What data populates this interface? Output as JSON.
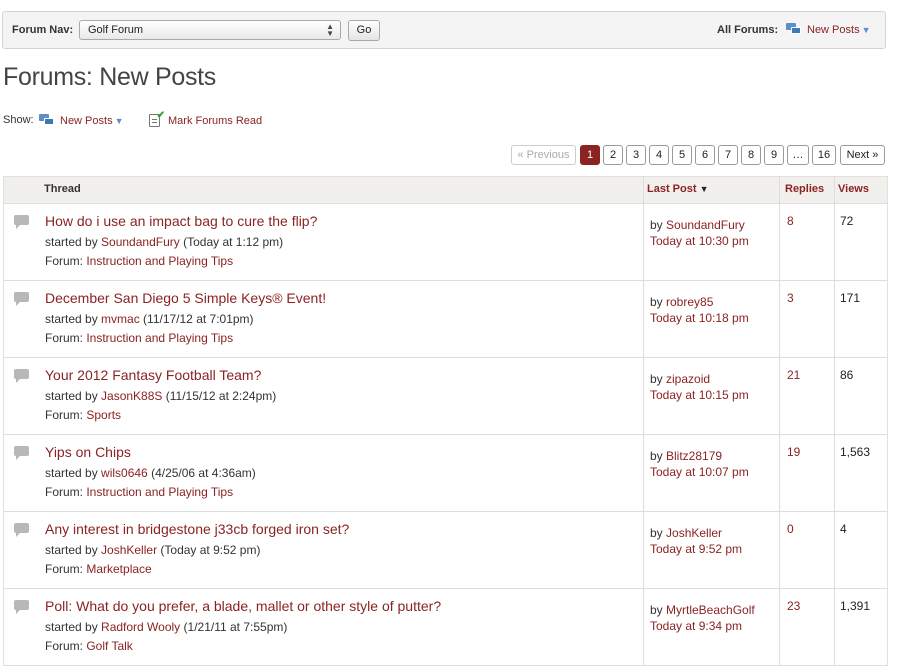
{
  "nav": {
    "label": "Forum Nav:",
    "selected_forum": "Golf Forum",
    "go_label": "Go",
    "all_forums_label": "All Forums:",
    "new_posts_label": "New Posts"
  },
  "page_title": "Forums: New Posts",
  "show": {
    "label": "Show:",
    "new_posts_label": "New Posts",
    "mark_read_label": "Mark Forums Read"
  },
  "pagination": {
    "previous": "« Previous",
    "pages": [
      "1",
      "2",
      "3",
      "4",
      "5",
      "6",
      "7",
      "8",
      "9",
      "…",
      "16"
    ],
    "current": "1",
    "next": "Next »"
  },
  "table": {
    "headers": {
      "thread": "Thread",
      "last_post": "Last Post",
      "replies": "Replies",
      "views": "Views"
    },
    "rows": [
      {
        "title": "How do i use an impact bag to cure the flip?",
        "started_prefix": "started by ",
        "author": "SoundandFury",
        "started_when": " (Today at 1:12 pm)",
        "forum_prefix": "Forum: ",
        "forum": "Instruction and Playing Tips",
        "last_by_prefix": "by ",
        "last_by": "SoundandFury",
        "last_when": "Today at 10:30 pm",
        "replies": "8",
        "views": "72"
      },
      {
        "title": "December San Diego 5 Simple Keys® Event!",
        "started_prefix": "started by ",
        "author": "mvmac",
        "started_when": " (11/17/12 at 7:01pm)",
        "forum_prefix": "Forum: ",
        "forum": "Instruction and Playing Tips",
        "last_by_prefix": "by ",
        "last_by": "robrey85",
        "last_when": "Today at 10:18 pm",
        "replies": "3",
        "views": "171"
      },
      {
        "title": "Your 2012 Fantasy Football Team?",
        "started_prefix": "started by ",
        "author": "JasonK88S",
        "started_when": " (11/15/12 at 2:24pm)",
        "forum_prefix": "Forum: ",
        "forum": "Sports",
        "last_by_prefix": "by ",
        "last_by": "zipazoid",
        "last_when": "Today at 10:15 pm",
        "replies": "21",
        "views": "86"
      },
      {
        "title": "Yips on Chips",
        "started_prefix": "started by ",
        "author": "wils0646",
        "started_when": " (4/25/06 at 4:36am)",
        "forum_prefix": "Forum: ",
        "forum": "Instruction and Playing Tips",
        "last_by_prefix": "by ",
        "last_by": "Blitz28179",
        "last_when": "Today at 10:07 pm",
        "replies": "19",
        "views": "1,563"
      },
      {
        "title": "Any interest in bridgestone j33cb forged iron set?",
        "started_prefix": "started by ",
        "author": "JoshKeller",
        "started_when": " (Today at 9:52 pm)",
        "forum_prefix": "Forum: ",
        "forum": "Marketplace",
        "last_by_prefix": "by ",
        "last_by": "JoshKeller",
        "last_when": "Today at 9:52 pm",
        "replies": "0",
        "views": "4"
      },
      {
        "title": "Poll: What do you prefer, a blade, mallet or other style of putter?",
        "started_prefix": "started by ",
        "author": "Radford Wooly",
        "started_when": " (1/21/11 at 7:55pm)",
        "forum_prefix": "Forum: ",
        "forum": "Golf Talk",
        "last_by_prefix": "by ",
        "last_by": "MyrtleBeachGolf",
        "last_when": "Today at 9:34 pm",
        "replies": "23",
        "views": "1,391"
      }
    ]
  }
}
